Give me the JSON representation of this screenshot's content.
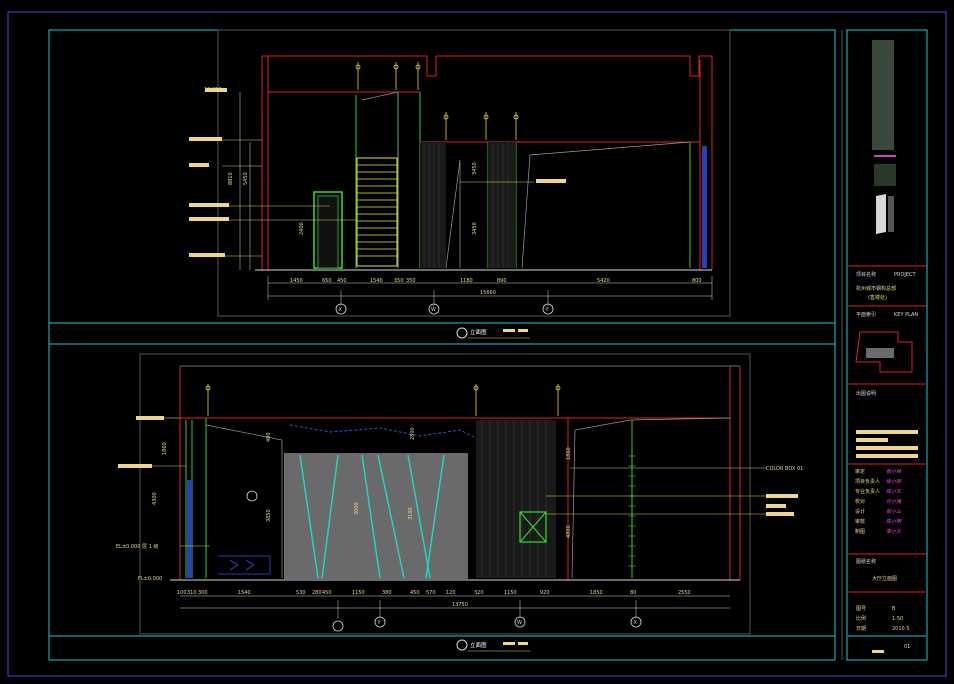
{
  "drawing": {
    "elevation_top": {
      "label": "立面图",
      "total_dim": "15660",
      "axes": [
        "X",
        "W",
        "Y"
      ],
      "dims": [
        "1450",
        "650",
        "450",
        "1540",
        "350",
        "350",
        "1180",
        "890",
        "5420",
        "800"
      ],
      "height_dims": [
        "8810",
        "5450",
        "3450",
        "3450",
        "2400"
      ],
      "level_mark": "12.950"
    },
    "elevation_bottom": {
      "label": "立面图",
      "total_dim": "13750",
      "axes": [
        "Y",
        "W",
        "X"
      ],
      "dims": [
        "100",
        "310",
        "300",
        "1540",
        "530",
        "280",
        "450",
        "1150",
        "380",
        "450",
        "570",
        "120",
        "320",
        "1150",
        "920",
        "1850",
        "80",
        "2550"
      ],
      "height_dims": [
        "1860",
        "4300",
        "480",
        "3850",
        "3000",
        "3100",
        "2800",
        "1860",
        "4800"
      ],
      "left_tags": [
        "EL±0.000 层 1 级",
        "FL±0.000"
      ],
      "right_tags": [
        "COLOR BOX 01"
      ]
    }
  },
  "title_block": {
    "project_label": "项目名称",
    "project_label_en": "PROJECT",
    "project_name": "杭州城市钢构总部",
    "project_sub": "(售楼处)",
    "key_plan_label": "平面索引",
    "key_plan_en": "KEY PLAN",
    "notes_label": "出图说明",
    "sign_rows": [
      {
        "role": "审定",
        "name": "张小林"
      },
      {
        "role": "项目负责人",
        "name": "徐小刚"
      },
      {
        "role": "专业负责人",
        "name": "陈小东"
      },
      {
        "role": "校对",
        "name": "许小强"
      },
      {
        "role": "设计",
        "name": "张小山"
      },
      {
        "role": "审核",
        "name": "陈小明"
      },
      {
        "role": "制图",
        "name": "李小兰"
      }
    ],
    "drawing_name_label": "图纸名称",
    "drawing_name": "大厅立面图",
    "info_rows": [
      {
        "k": "图号",
        "v": "B"
      },
      {
        "k": "比例",
        "v": "1:50"
      },
      {
        "k": "日期",
        "v": "2010.5"
      }
    ],
    "sheet": "01"
  }
}
